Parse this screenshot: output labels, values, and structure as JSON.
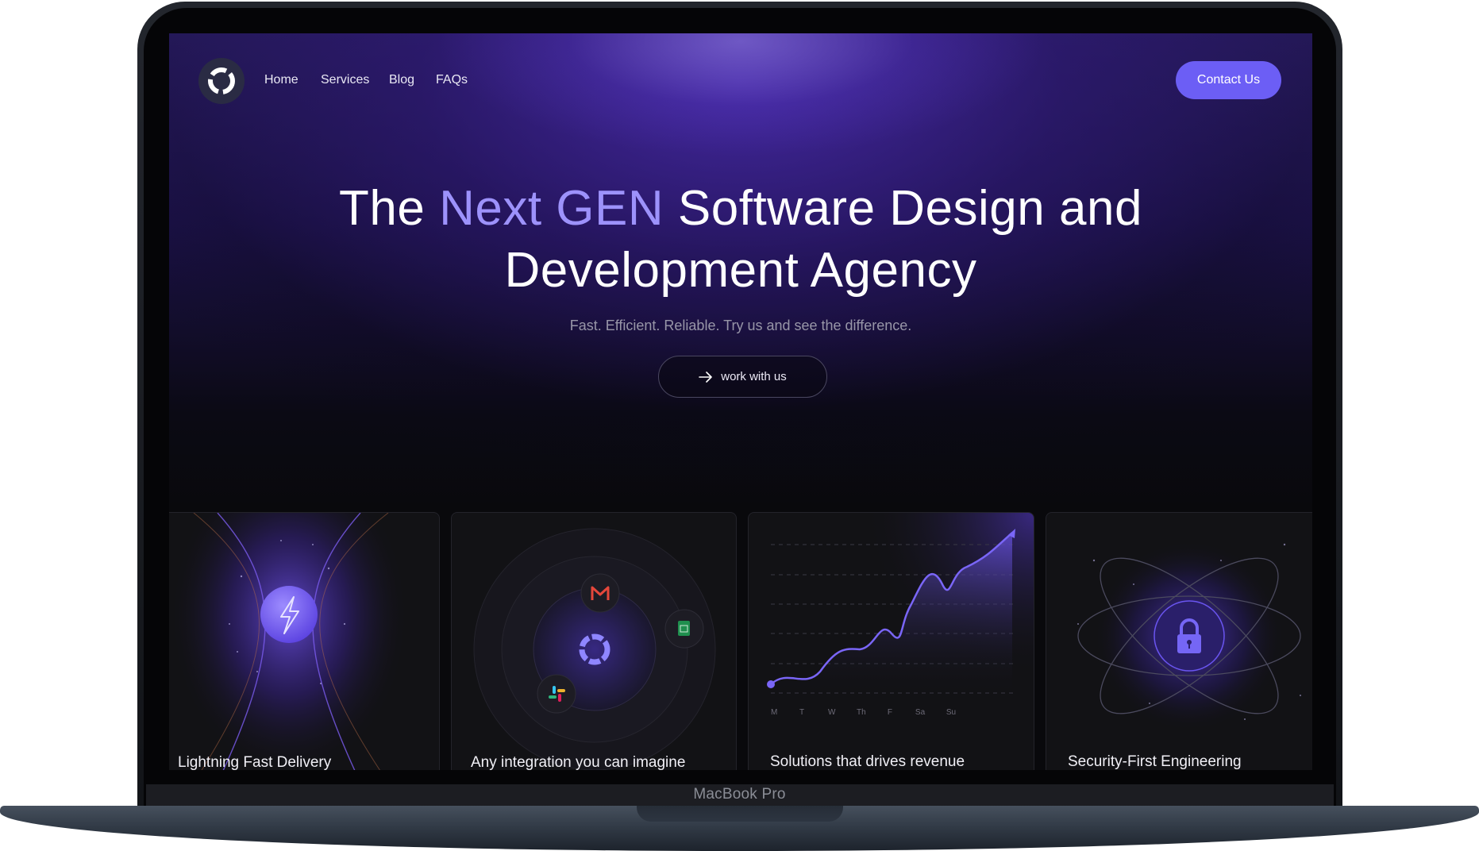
{
  "nav": {
    "links": [
      "Home",
      "Services",
      "Blog",
      "FAQs"
    ],
    "contact_label": "Contact Us"
  },
  "hero": {
    "title_pre": "The ",
    "title_accent": "Next GEN",
    "title_post1": " Software Design and",
    "title_line2": "Development Agency",
    "subtitle": "Fast. Efficient. Reliable. Try us and see the difference.",
    "cta_label": "work with us"
  },
  "cards": [
    {
      "title": "Lightning Fast Delivery"
    },
    {
      "title": "Any integration you can imagine"
    },
    {
      "title": "Solutions that drives revenue",
      "chart_days": [
        "M",
        "T",
        "W",
        "Th",
        "F",
        "Sa",
        "Su"
      ]
    },
    {
      "title": "Security-First Engineering"
    }
  ],
  "device": {
    "label": "MacBook Pro"
  },
  "colors": {
    "accent": "#6c5ef5",
    "accent_text": "#9d92fb",
    "background": "#09090c"
  }
}
